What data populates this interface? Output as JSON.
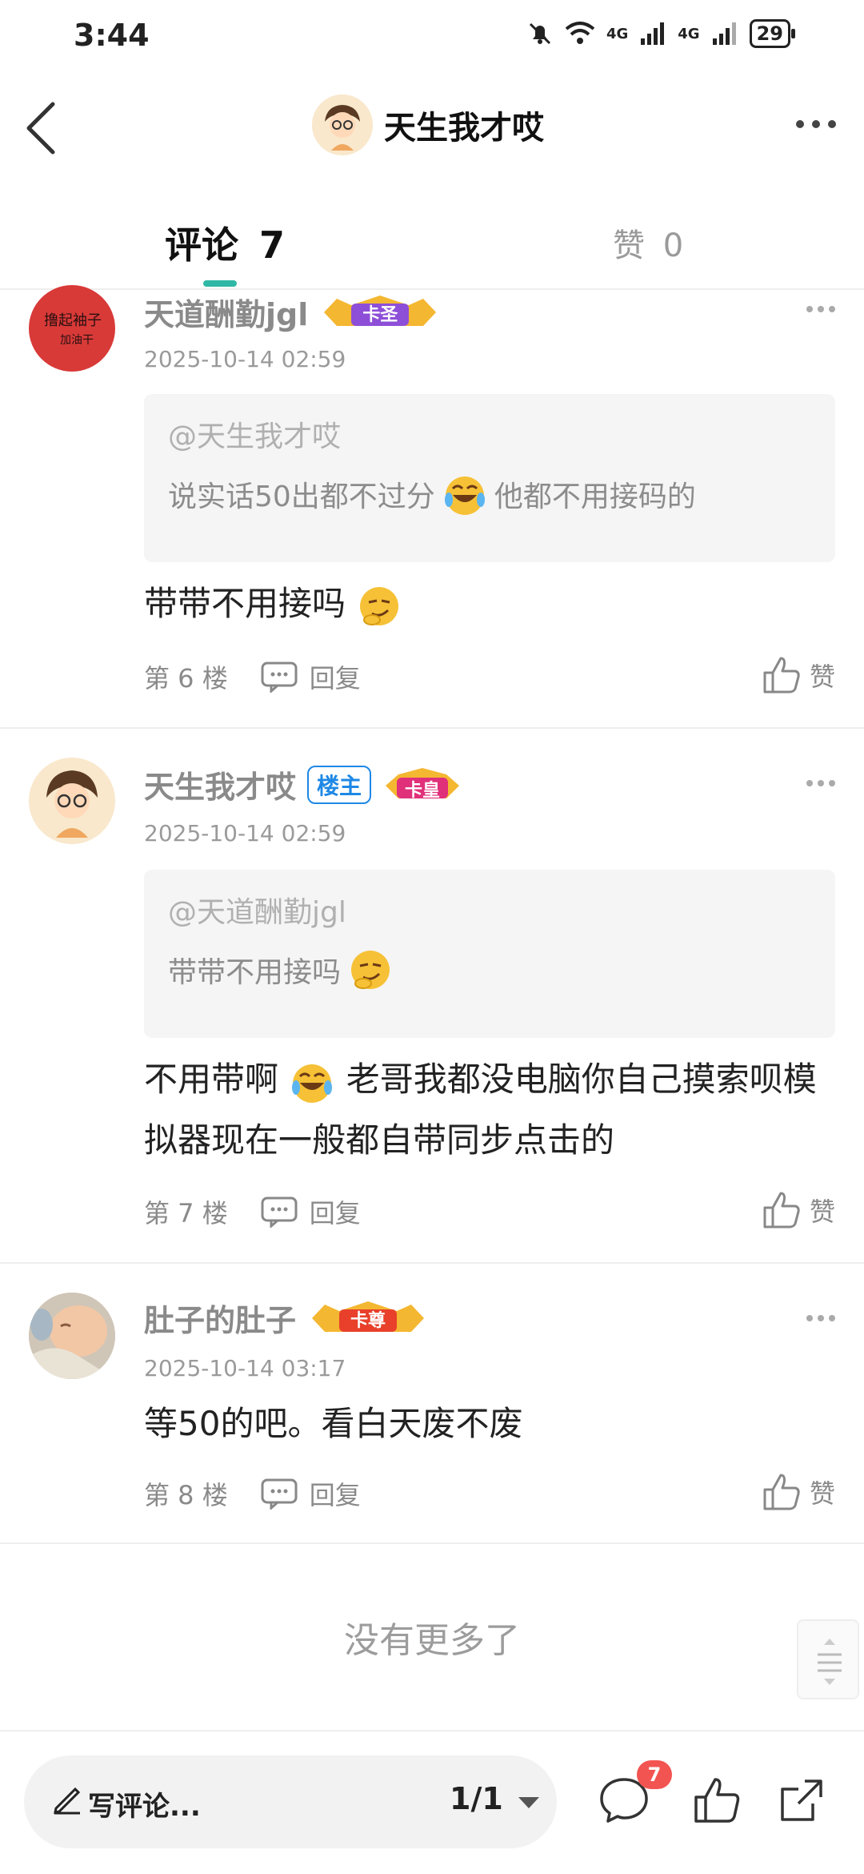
{
  "status_bar": {
    "time": "3:44",
    "network_1": "4G",
    "network_2": "4G",
    "battery": "29"
  },
  "header": {
    "title": "天生我才哎"
  },
  "tabs": {
    "comments_label": "评论",
    "comments_count": "7",
    "likes_label": "赞",
    "likes_count": "0"
  },
  "comments": [
    {
      "user": "天道酬勤jgl",
      "avatar_text_1": "撸起袖子",
      "avatar_text_2": "加油干",
      "rank": "卡圣",
      "time": "2025-10-14 02:59",
      "quote_mention": "@天生我才哎",
      "quote_text_a": "说实话50出都不过分",
      "quote_text_b": "他都不用接码的",
      "content": "带带不用接吗",
      "floor": "第 6 楼",
      "reply": "回复",
      "like": "赞"
    },
    {
      "user": "天生我才哎",
      "host_badge": "楼主",
      "rank": "卡皇",
      "time": "2025-10-14 02:59",
      "quote_mention": "@天道酬勤jgl",
      "quote_text_a": "带带不用接吗",
      "content_a": "不用带啊",
      "content_b": "老哥我都没电脑你自己摸索呗模拟器现在一般都自带同步点击的",
      "floor": "第 7 楼",
      "reply": "回复",
      "like": "赞"
    },
    {
      "user": "肚子的肚子",
      "rank": "卡尊",
      "time": "2025-10-14 03:17",
      "content": "等50的吧。看白天废不废",
      "floor": "第 8 楼",
      "reply": "回复",
      "like": "赞"
    }
  ],
  "footer": {
    "no_more": "没有更多了"
  },
  "bottom_bar": {
    "write_placeholder": "写评论...",
    "page_indicator": "1/1",
    "comment_badge": "7"
  },
  "colors": {
    "accent": "#2fb8a5",
    "host_blue": "#1e88e5",
    "badge_red": "#f25451",
    "rank_purple": "#8e4fd8",
    "rank_pink": "#e0307a",
    "rank_red": "#e8402a"
  }
}
